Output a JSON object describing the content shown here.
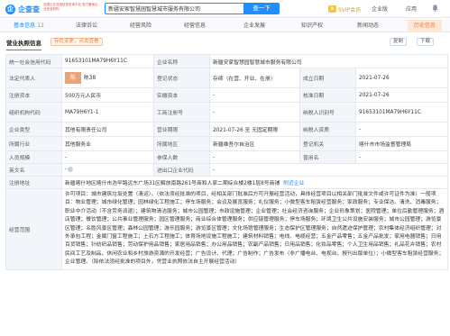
{
  "header": {
    "logo_mark": "企",
    "logo_text": "企查查",
    "logo_sub": "全国企业信用信息查询平台 官方备案企业征信机构",
    "search_value": "新疆安家智慧园智慧城市服务有限公司",
    "search_button": "查一下",
    "vip_label": "SVIP会员",
    "enterprise_label": "企业版",
    "app_label": "应用"
  },
  "tabs": [
    {
      "label": "基本信息",
      "count": "12"
    },
    {
      "label": "法律诉讼",
      "count": ""
    },
    {
      "label": "经营风险",
      "count": ""
    },
    {
      "label": "经营信息",
      "count": ""
    },
    {
      "label": "企业发展",
      "count": ""
    },
    {
      "label": "知识产权",
      "count": ""
    },
    {
      "label": "新闻动态",
      "count": ""
    },
    {
      "label": "历史信息",
      "count": ""
    }
  ],
  "section": {
    "title": "营业执照信息",
    "notice": "存在变更，点击查看",
    "btn_copy": "复制",
    "btn_download": "下载"
  },
  "info": {
    "credit_code_label": "统一社会信用代码",
    "credit_code": "91653101MA79H6Y11C",
    "company_name_label": "企业名称",
    "company_name": "新疆安家智慧园智慧城市服务有限公司",
    "legal_rep_label": "法定代表人",
    "legal_rep_avatar": "陈",
    "legal_rep": "陈38",
    "status_label": "登记状态",
    "status": "存续（在营、开业、在册）",
    "established_label": "成立日期",
    "established": "2021-07-26",
    "reg_capital_label": "注册资本",
    "reg_capital": "500万元人民币",
    "paid_capital_label": "实缴资本",
    "paid_capital": "-",
    "approval_label": "核准日期",
    "approval": "2021-07-26",
    "org_code_label": "组织机构代码",
    "org_code": "MA79H6Y1-1",
    "biz_reg_label": "工商注册号",
    "biz_reg": "-",
    "tax_id_label": "纳税人识别号",
    "tax_id": "91653101MA79H6Y11C",
    "company_type_label": "企业类型",
    "company_type": "其他有限责任公司",
    "term_label": "营业期限",
    "term": "2021-07-26 至 无固定期限",
    "taxpayer_label": "纳税人资质",
    "taxpayer": "-",
    "industry_label": "所属行业",
    "industry": "其他服务业",
    "region_label": "所属地区",
    "region": "新疆维吾尔自治区",
    "authority_label": "登记机关",
    "authority": "喀什市市场监督管理局",
    "staff_label": "人员规模",
    "staff": "-",
    "insured_label": "参保人数",
    "insured": "-",
    "former_name_label": "曾用名",
    "former_name": "-",
    "en_name_label": "英文名",
    "en_name": "-",
    "import_export_label": "进出口企业代码",
    "import_export": "-",
    "address_label": "注册地址",
    "address": "新疆喀什地区喀什市浩罕路远东广场31区解放南路261号商和人家二期综合楼2楼1层8号商铺",
    "address_link": "附近企业",
    "scope_label": "经营范围",
    "scope": "许可项目：城市建筑垃圾处置（清运）。（依法须经批准的项目，经相关部门批准后方可开展经营活动，具体经营项目以相关部门批准文件或许可证件为准）一般项目：物业管理；城市绿化管理；园林绿化工程施工；停车场服务；会议及展览服务；礼仪服务；小微型客车租赁经营服务；家政服务；专业保洁、清洗、消毒服务；职业中介活动（不含劳务派遣）；建筑物清洁服务；城市公园管理；市政设施管理；企业管理；社会经济咨询服务；企业形象策划；医院管理；单位后勤管理服务；酒店管理；餐饮管理；公共事业管理服务；园区管理服务；商业综合体管理服务；供应链管理服务；停车场服务；环境卫生公共设施安装服务；城市公园管理；游览景区管理；名胜风景区管理；森林公园管理；游乐园服务；游览景区管理；文化场馆管理服务；生态保护区管理服务；自然遗迹保护管理；农村集体经济组织管理；对外承包工程；金属门窗工程施工；土石方工程施工；体育场地设施工程施工；建筑材料销售；电线、电缆经营；五金产品零售；五金产品批发；家用电器销售；日用百货销售；针纺织品销售；劳动保护用品销售；家居用品销售；办公用品销售；农副产品销售；日用品销售；化妆品零售；个人卫生用品销售；礼品花卉销售；农村民间工艺及制品、休闲农业和乡村旅游资源的开发经营；广告设计、代理；广告制作；广告发布（非广播电台、电视台、报刊出版单位）；小微型客车租赁经营服务；企业管理。（除依法须经批准的项目外，凭营业执照依法自主开展经营活动）"
  }
}
